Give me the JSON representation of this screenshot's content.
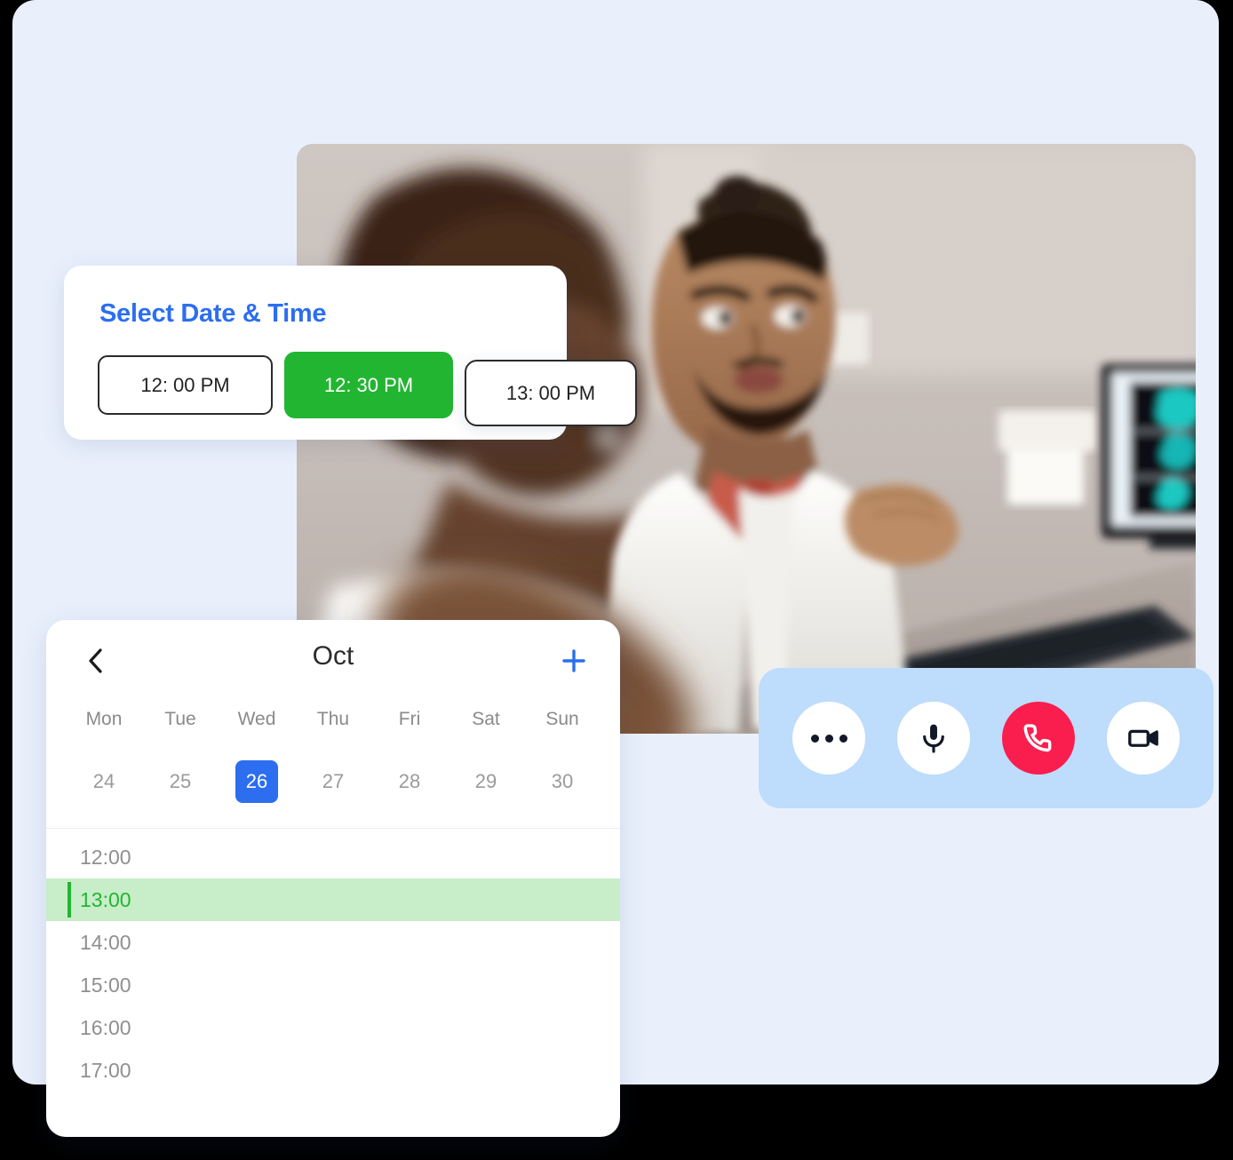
{
  "theme": {
    "page_background": "#E9F0FC",
    "accent_blue": "#2C6EEF",
    "accent_green": "#22B531",
    "highlight_green": "#C8EDC9",
    "danger_red": "#FA1E4E",
    "call_bar_blue": "#BEDCFB"
  },
  "datetime_card": {
    "title": "Select Date & Time",
    "slots": [
      {
        "label": "12: 00 PM",
        "selected": false
      },
      {
        "label": "12: 30 PM",
        "selected": true
      },
      {
        "label": "13: 00 PM",
        "selected": false
      }
    ]
  },
  "calendar": {
    "prev_icon": "chevron-left-icon",
    "month": "Oct",
    "add_icon": "plus-icon",
    "day_names": [
      "Mon",
      "Tue",
      "Wed",
      "Thu",
      "Fri",
      "Sat",
      "Sun"
    ],
    "days": [
      {
        "number": "24",
        "selected": false
      },
      {
        "number": "25",
        "selected": false
      },
      {
        "number": "26",
        "selected": true
      },
      {
        "number": "27",
        "selected": false
      },
      {
        "number": "28",
        "selected": false
      },
      {
        "number": "29",
        "selected": false
      },
      {
        "number": "30",
        "selected": false
      }
    ],
    "time_slots": [
      {
        "label": "12:00",
        "active": false
      },
      {
        "label": "13:00",
        "active": true
      },
      {
        "label": "14:00",
        "active": false
      },
      {
        "label": "15:00",
        "active": false
      },
      {
        "label": "16:00",
        "active": false
      },
      {
        "label": "17:00",
        "active": false
      }
    ]
  },
  "call_bar": {
    "buttons": [
      {
        "icon": "more-options-icon",
        "style": "light"
      },
      {
        "icon": "microphone-icon",
        "style": "light"
      },
      {
        "icon": "end-call-icon",
        "style": "danger"
      },
      {
        "icon": "video-camera-icon",
        "style": "light"
      }
    ]
  },
  "hero_photo": {
    "alt": "two medical professionals in white coats talking at a desk with a monitor showing scans"
  }
}
